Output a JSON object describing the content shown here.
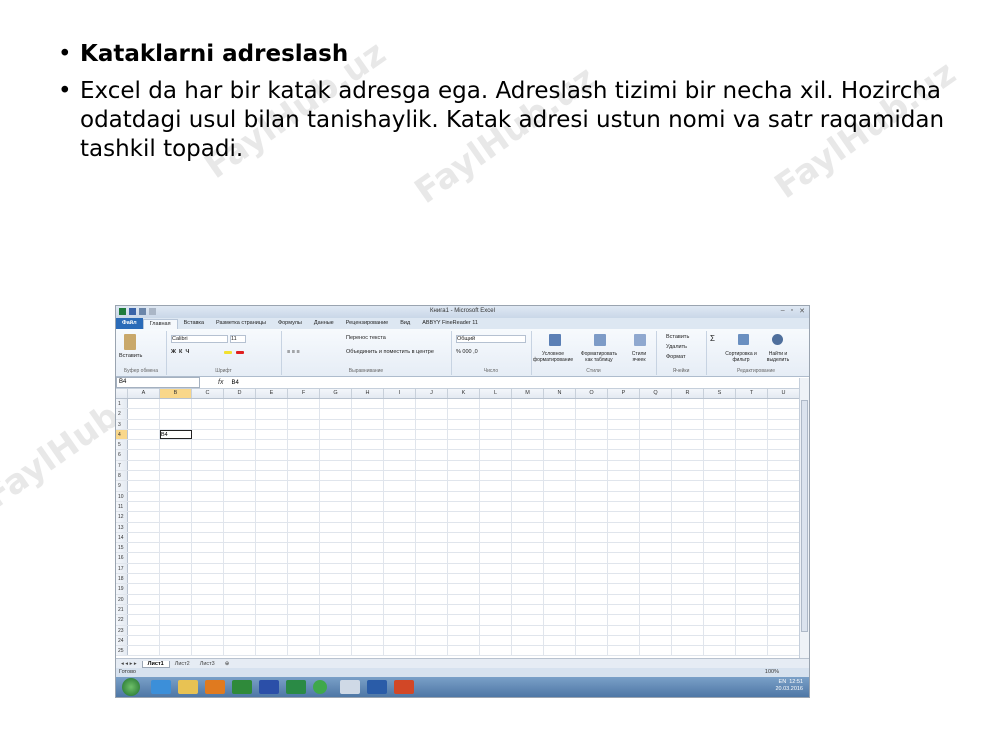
{
  "bullets": [
    {
      "text": "Kataklarni adreslash",
      "bold": true
    },
    {
      "text": "Excel da har bir katak adresga ega. Adreslash tizimi bir necha xil. Hozircha odatdagi usul bilan tanishaylik. Katak adresi ustun nomi va satr raqamidan tashkil topadi.",
      "bold": false
    }
  ],
  "watermark": "FaylHub.uz",
  "excel": {
    "window_title": "Книга1 - Microsoft Excel",
    "tabs": [
      "Файл",
      "Главная",
      "Вставка",
      "Разметка страницы",
      "Формулы",
      "Данные",
      "Рецензирование",
      "Вид",
      "ABBYY FineReader 11"
    ],
    "ribbon": {
      "paste": "Вставить",
      "clipboard": "Буфер обмена",
      "font_name": "Calibri",
      "font_size": "11",
      "font_group": "Шрифт",
      "wrap_text": "Перенос текста",
      "merge_center": "Объединить и поместить в центре",
      "alignment_group": "Выравнивание",
      "number_format": "Общий",
      "number_group": "Число",
      "conditional": "Условное форматирование",
      "format_table": "Форматировать как таблицу",
      "cell_styles": "Стили ячеек",
      "styles_group": "Стили",
      "insert": "Вставить",
      "delete": "Удалить",
      "format": "Формат",
      "cells_group": "Ячейки",
      "sort_filter": "Сортировка и фильтр",
      "find_select": "Найти и выделить",
      "editing_group": "Редактирование"
    },
    "name_box": "B4",
    "fx": "fx",
    "formula_value": "B4",
    "columns": [
      "A",
      "B",
      "C",
      "D",
      "E",
      "F",
      "G",
      "H",
      "I",
      "J",
      "K",
      "L",
      "M",
      "N",
      "O",
      "P",
      "Q",
      "R",
      "S",
      "T",
      "U"
    ],
    "rows": [
      "1",
      "2",
      "3",
      "4",
      "5",
      "6",
      "7",
      "8",
      "9",
      "10",
      "11",
      "12",
      "13",
      "14",
      "15",
      "16",
      "17",
      "18",
      "19",
      "20",
      "21",
      "22",
      "23",
      "24",
      "25"
    ],
    "active_cell_value": "B4",
    "sheets": [
      "Лист1",
      "Лист2",
      "Лист3"
    ],
    "status": "Готово",
    "zoom": "100%",
    "tray_lang": "EN",
    "tray_time": "12:51",
    "tray_date": "20.03.2016"
  }
}
